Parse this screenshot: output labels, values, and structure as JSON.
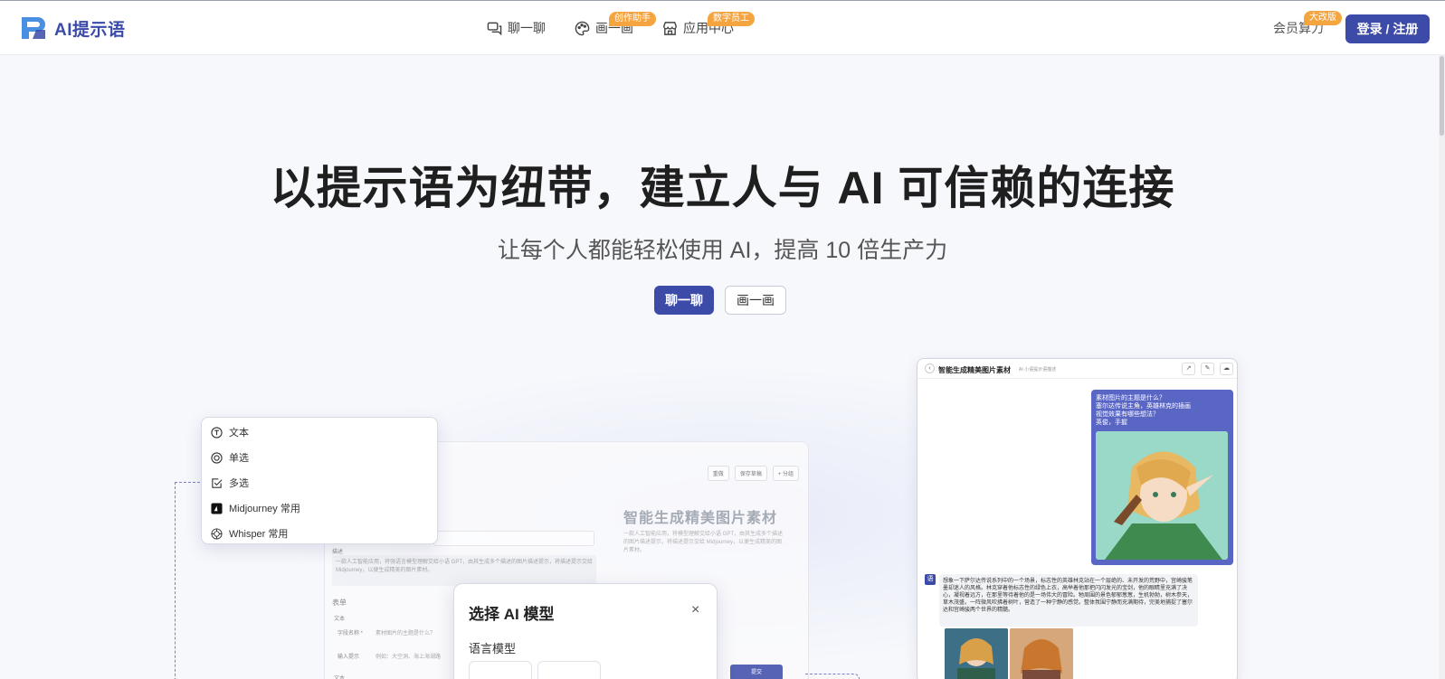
{
  "brand": {
    "logo_text": "AI提示语"
  },
  "nav": {
    "items": [
      {
        "label": "聊一聊",
        "icon": "chat-icon",
        "badge": ""
      },
      {
        "label": "画一画",
        "icon": "palette-icon",
        "badge": "创作助手"
      },
      {
        "label": "应用中心",
        "icon": "store-icon",
        "badge": "数字员工"
      }
    ],
    "member": {
      "label": "会员算力",
      "badge": "大改版"
    },
    "login_label": "登录 / 注册"
  },
  "hero": {
    "title": "以提示语为纽带，建立人与 AI 可信赖的连接",
    "subtitle": "让每个人都能轻松使用 AI，提高 10 倍生产力",
    "primary_cta": "聊一聊",
    "secondary_cta": "画一画"
  },
  "type_menu": {
    "items": [
      {
        "label": "文本",
        "icon": "text-t-icon"
      },
      {
        "label": "单选",
        "icon": "radio-icon"
      },
      {
        "label": "多选",
        "icon": "checkbox-icon"
      },
      {
        "label": "Midjourney 常用",
        "icon": "midjourney-icon"
      },
      {
        "label": "Whisper 常用",
        "icon": "openai-icon"
      }
    ]
  },
  "editor": {
    "tools": [
      "重做",
      "保存草稿",
      "+ 分组"
    ],
    "desc_label": "描述",
    "desc_text": "一款人工智能应用，将强语言模型理解交给小语 GPT，由其生成多个描述的图片描述提示，将描述提示交给 Midjourney，以便生成精美的图片素材。",
    "form_label": "表单",
    "text_label": "文本",
    "field_name_label": "字段名称 *",
    "field_name_value": "素材图片的主题是什么？",
    "input_hint_label": "输入提示",
    "input_hint_value": "例如：大空洞、海上海湖路",
    "text_label_2": "文本",
    "preview_title": "智能生成精美图片素材",
    "preview_desc": "一款人工智能应用，将模型理解交给小语 GPT，由其生成多个描述的图片描述提示，将描述提示交给 Midjourney，以便生成精美的图片素材。",
    "submit_label": "提交"
  },
  "modal": {
    "title": "选择 AI 模型",
    "close": "×",
    "section": "语言模型"
  },
  "chat": {
    "title": "智能生成精美图片素材",
    "subtitle": "AI 小语提示语描述",
    "user_text": "素材图片的主题是什么？\n塞尔达传说主角，英雄林克的插画\n视觉效果有哪些想法？\n英俊，手握",
    "bot_text": "想象一下萨尔达传说系列中的一个场景，标志性的英雄林克站在一个层绝的、未开发的荒野中，宫崎骏笔墨却迷人的风格。林克穿着他标志性的绿色上衣，高举着他那把闪闪发光的宝剑，他的眼睛里充满了决心，凝视着远方，在那里等待着他的是一场伟大的冒险。牠周围的景色郁郁葱葱，生机勃勃，树木参天，草木茂盛。一阵微风吹拂着树叶，营造了一种宁静的感觉。整体氛围宁静而充满期待，完美地捕捉了塞尔达和宫崎骏两个世界的精髓。",
    "bot_icon": "语"
  }
}
